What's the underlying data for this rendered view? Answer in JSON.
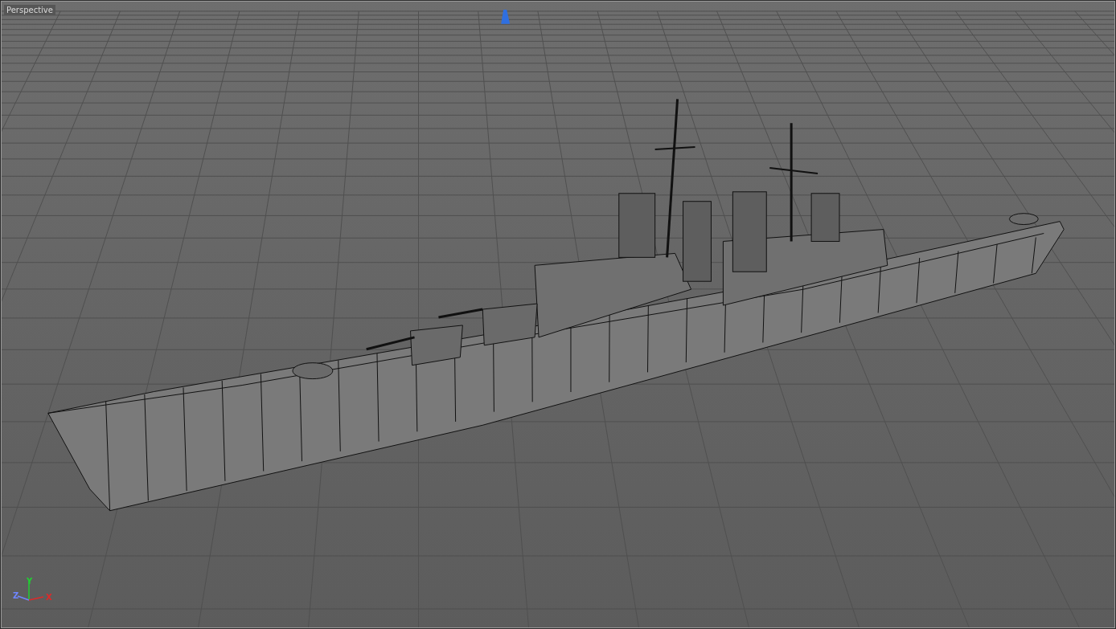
{
  "viewport": {
    "title": "Perspective"
  },
  "axis_gizmo": {
    "axes": [
      {
        "kind": "y",
        "label": "Y"
      },
      {
        "kind": "z",
        "label": "Z"
      },
      {
        "kind": "x",
        "label": "X"
      }
    ]
  }
}
